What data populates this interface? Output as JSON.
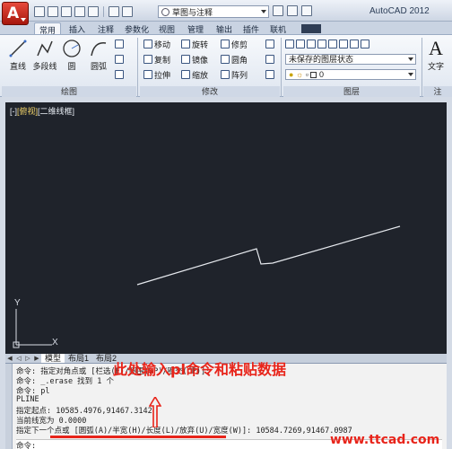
{
  "title": {
    "app_name": "AutoCAD 2012",
    "workspace": "草图与注释"
  },
  "tabs": [
    "常用",
    "插入",
    "注释",
    "参数化",
    "视图",
    "管理",
    "输出",
    "插件",
    "联机"
  ],
  "ribbon": {
    "draw": {
      "title": "绘图",
      "tools": [
        "直线",
        "多段线",
        "圆",
        "圆弧"
      ]
    },
    "modify": {
      "title": "修改",
      "tools": [
        "移动",
        "旋转",
        "修剪",
        "复制",
        "镜像",
        "圆角",
        "拉伸",
        "缩放",
        "阵列"
      ]
    },
    "layers": {
      "title": "图层",
      "layer_state": "未保存的图层状态",
      "current_layer": "0"
    },
    "annotation": {
      "title": "注",
      "text_label": "文字"
    }
  },
  "viewport": {
    "label_prefix": "[-]",
    "label_view": "[俯视]",
    "label_style": "[二维线框]",
    "ucs_y": "Y",
    "ucs_x": "X"
  },
  "layout_tabs": [
    "模型",
    "布局1",
    "布局2"
  ],
  "command_history": [
    "命令: 指定对角点或 [栏选(F)/圈围(WP)/圈交(CP)]:",
    "命令: _.erase 找到 1 个",
    "命令: pl",
    "PLINE",
    "指定起点: 10585.4976,91467.3142",
    "当前线宽为 0.0000",
    "指定下一个点或 [圆弧(A)/半宽(H)/长度(L)/放弃(U)/宽度(W)]: 10584.7269,91467.0987"
  ],
  "command_prompt": "命令:",
  "annotation_text": "此处输入pl命令和粘贴数据",
  "watermark": "www.ttcad.com",
  "colors": {
    "annotation": "#e8241a",
    "drawing_bg": "#1f232b"
  }
}
